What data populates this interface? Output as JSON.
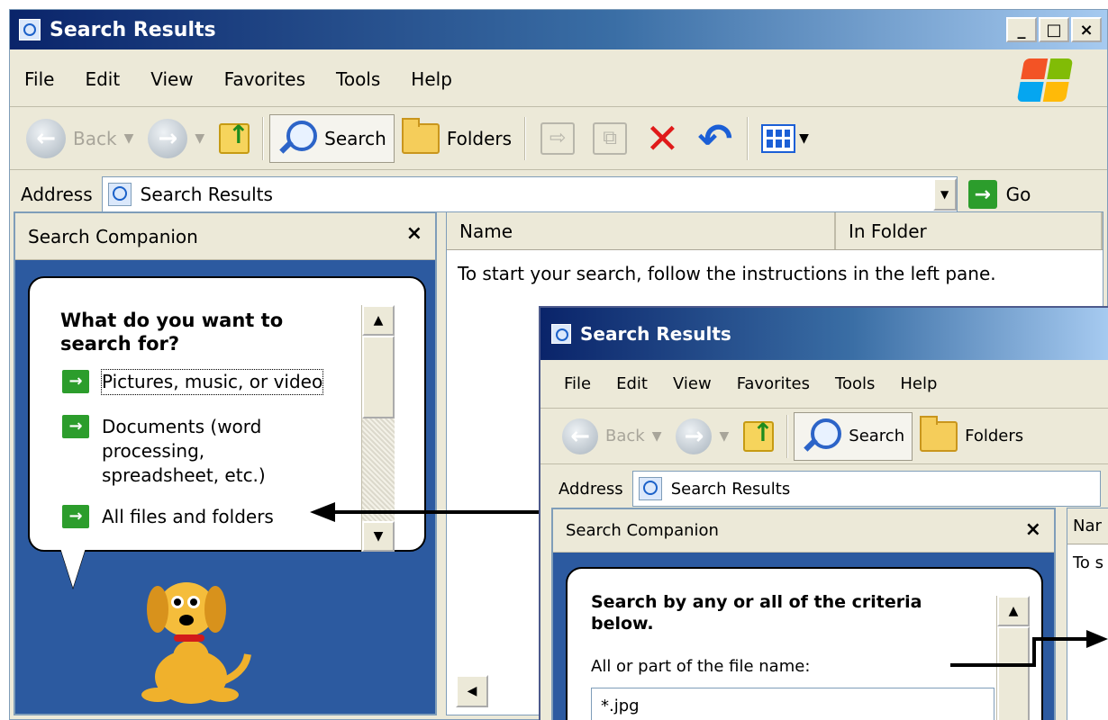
{
  "window_back": {
    "title": "Search Results",
    "caption_buttons": [
      "_",
      "□",
      "×"
    ],
    "menu": [
      "File",
      "Edit",
      "View",
      "Favorites",
      "Tools",
      "Help"
    ],
    "toolbar": {
      "back": "Back",
      "search": "Search",
      "folders": "Folders"
    },
    "address": {
      "label": "Address",
      "value": "Search Results",
      "go": "Go"
    },
    "companion": {
      "title": "Search Companion",
      "close": "×",
      "question": "What do you want to search for?",
      "options": [
        "Pictures, music, or video",
        "Documents (word processing, spreadsheet, etc.)",
        "All files and folders"
      ]
    },
    "list": {
      "columns": [
        "Name",
        "In Folder"
      ],
      "empty_message": "To start your search, follow the instructions in the left pane."
    }
  },
  "window_front": {
    "title": "Search Results",
    "menu": [
      "File",
      "Edit",
      "View",
      "Favorites",
      "Tools",
      "Help"
    ],
    "toolbar": {
      "back": "Back",
      "search": "Search",
      "folders": "Folders"
    },
    "address": {
      "label": "Address",
      "value": "Search Results"
    },
    "companion": {
      "title": "Search Companion",
      "close": "×",
      "question": "Search by any or all of the criteria below.",
      "filename_label": "All or part of the file name:",
      "filename_value": "*.jpg"
    },
    "list": {
      "column_partial": "Nar",
      "message_partial": "To s"
    }
  },
  "colors": {
    "titlebar": "#0a246a",
    "companion_bg": "#2c5aa0",
    "go_green": "#2c9d2c",
    "delete_red": "#e01a1a"
  }
}
